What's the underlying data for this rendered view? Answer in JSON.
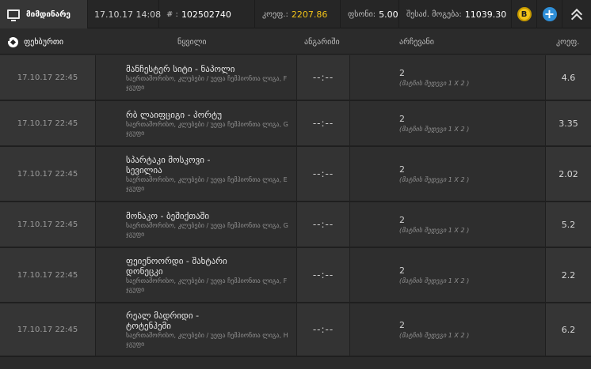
{
  "topbar": {
    "current_label": "მიმდინარე",
    "datetime": "17.10.17 14:08",
    "ticket_label": "# :",
    "ticket_number": "102502740",
    "coef_label": "კოეფ.:",
    "coef_value": "2207.86",
    "stake_label": "ფსონი:",
    "stake_value": "5.00",
    "win_label": "შესაძ. მოგება:",
    "win_value": "11039.30",
    "bonus_icon_text": "B",
    "plus_icon_text": "+"
  },
  "header": {
    "sport": "ფეხბურთი",
    "event": "ნყვილი",
    "score": "ანგარიში",
    "choice": "არჩევანი",
    "coef": "კოეფ."
  },
  "rows": [
    {
      "date": "17.10.17 22:45",
      "event": "მანჩესტერ სიტი - ნაპოლი",
      "league": "საერთაშორისო, კლუბები / უეფა ჩემპიონთა ლიგა, F ჯგუფი",
      "score": "--:--",
      "choice": "2",
      "choice_detail": "(მატჩის შედეგი 1 X 2 )",
      "coef": "4.6"
    },
    {
      "date": "17.10.17 22:45",
      "event": "რბ ლაიფციგი - პორტუ",
      "league": "საერთაშორისო, კლუბები / უეფა ჩემპიონთა ლიგა, G ჯგუფი",
      "score": "--:--",
      "choice": "2",
      "choice_detail": "(მატჩის შედეგი 1 X 2 )",
      "coef": "3.35"
    },
    {
      "date": "17.10.17 22:45",
      "event_line1": "სპარტაკი მოსკოვი -",
      "event_line2": "სევილია",
      "league": "საერთაშორისო, კლუბები / უეფა ჩემპიონთა ლიგა, E ჯგუფი",
      "score": "--:--",
      "choice": "2",
      "choice_detail": "(მატჩის შედეგი 1 X 2 )",
      "coef": "2.02"
    },
    {
      "date": "17.10.17 22:45",
      "event": "მონაკო - ბეშიქთაში",
      "league": "საერთაშორისო, კლუბები / უეფა ჩემპიონთა ლიგა, G ჯგუფი",
      "score": "--:--",
      "choice": "2",
      "choice_detail": "(მატჩის შედეგი 1 X 2 )",
      "coef": "5.2"
    },
    {
      "date": "17.10.17 22:45",
      "event_line1": "ფეიენოორდი - შახტარი",
      "event_line2": "დონეცკი",
      "league": "საერთაშორისო, კლუბები / უეფა ჩემპიონთა ლიგა, F ჯგუფი",
      "score": "--:--",
      "choice": "2",
      "choice_detail": "(მატჩის შედეგი 1 X 2 )",
      "coef": "2.2"
    },
    {
      "date": "17.10.17 22:45",
      "event_line1": "რეალ მადრიდი -",
      "event_line2": "ტოტენჰემი",
      "league": "საერთაშორისო, კლუბები / უეფა ჩემპიონთა ლიგა, H ჯგუფი",
      "score": "--:--",
      "choice": "2",
      "choice_detail": "(მატჩის შედეგი 1 X 2 )",
      "coef": "6.2"
    }
  ]
}
